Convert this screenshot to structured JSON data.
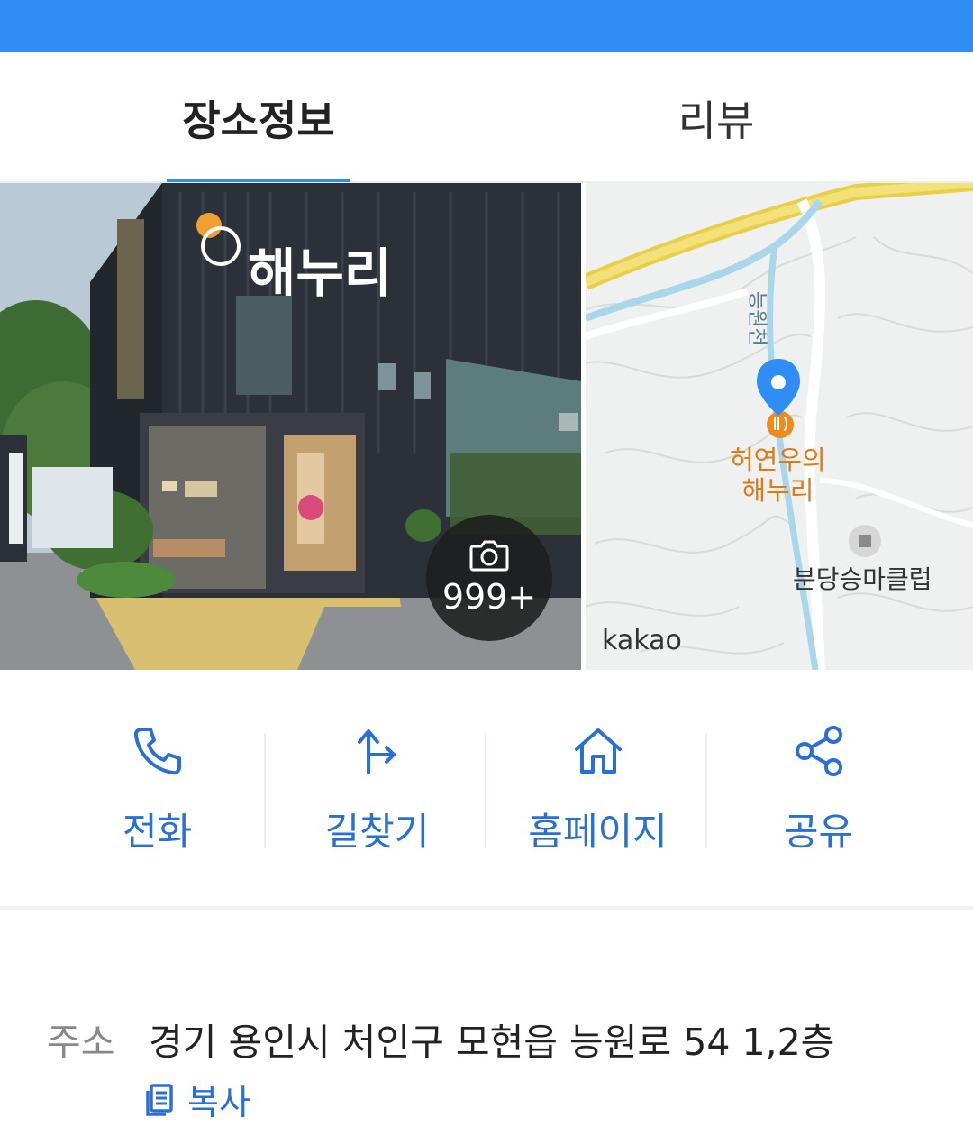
{
  "tabs": [
    {
      "label": "장소정보",
      "active": true
    },
    {
      "label": "리뷰",
      "active": false
    }
  ],
  "photo": {
    "count_label": "999+",
    "sign_text": "해누리",
    "icon": "camera-icon"
  },
  "map": {
    "poi_line1": "허연우의",
    "poi_line2": "해누리",
    "nearby_place": "분당승마클럽",
    "river_label": "능원천",
    "provider": "kakao",
    "marker_color": "#2f8df5",
    "poi_color": "#e07b12"
  },
  "actions": [
    {
      "label": "전화",
      "icon": "phone-icon"
    },
    {
      "label": "길찾기",
      "icon": "directions-icon"
    },
    {
      "label": "홈페이지",
      "icon": "home-icon"
    },
    {
      "label": "공유",
      "icon": "share-icon"
    }
  ],
  "address": {
    "key": "주소",
    "value": "경기 용인시 처인구 모현읍 능원로 54 1,2층",
    "copy_label": "복사",
    "copy_icon": "copy-icon"
  },
  "colors": {
    "accent": "#2f8df5",
    "action_text": "#2a6fd6"
  }
}
